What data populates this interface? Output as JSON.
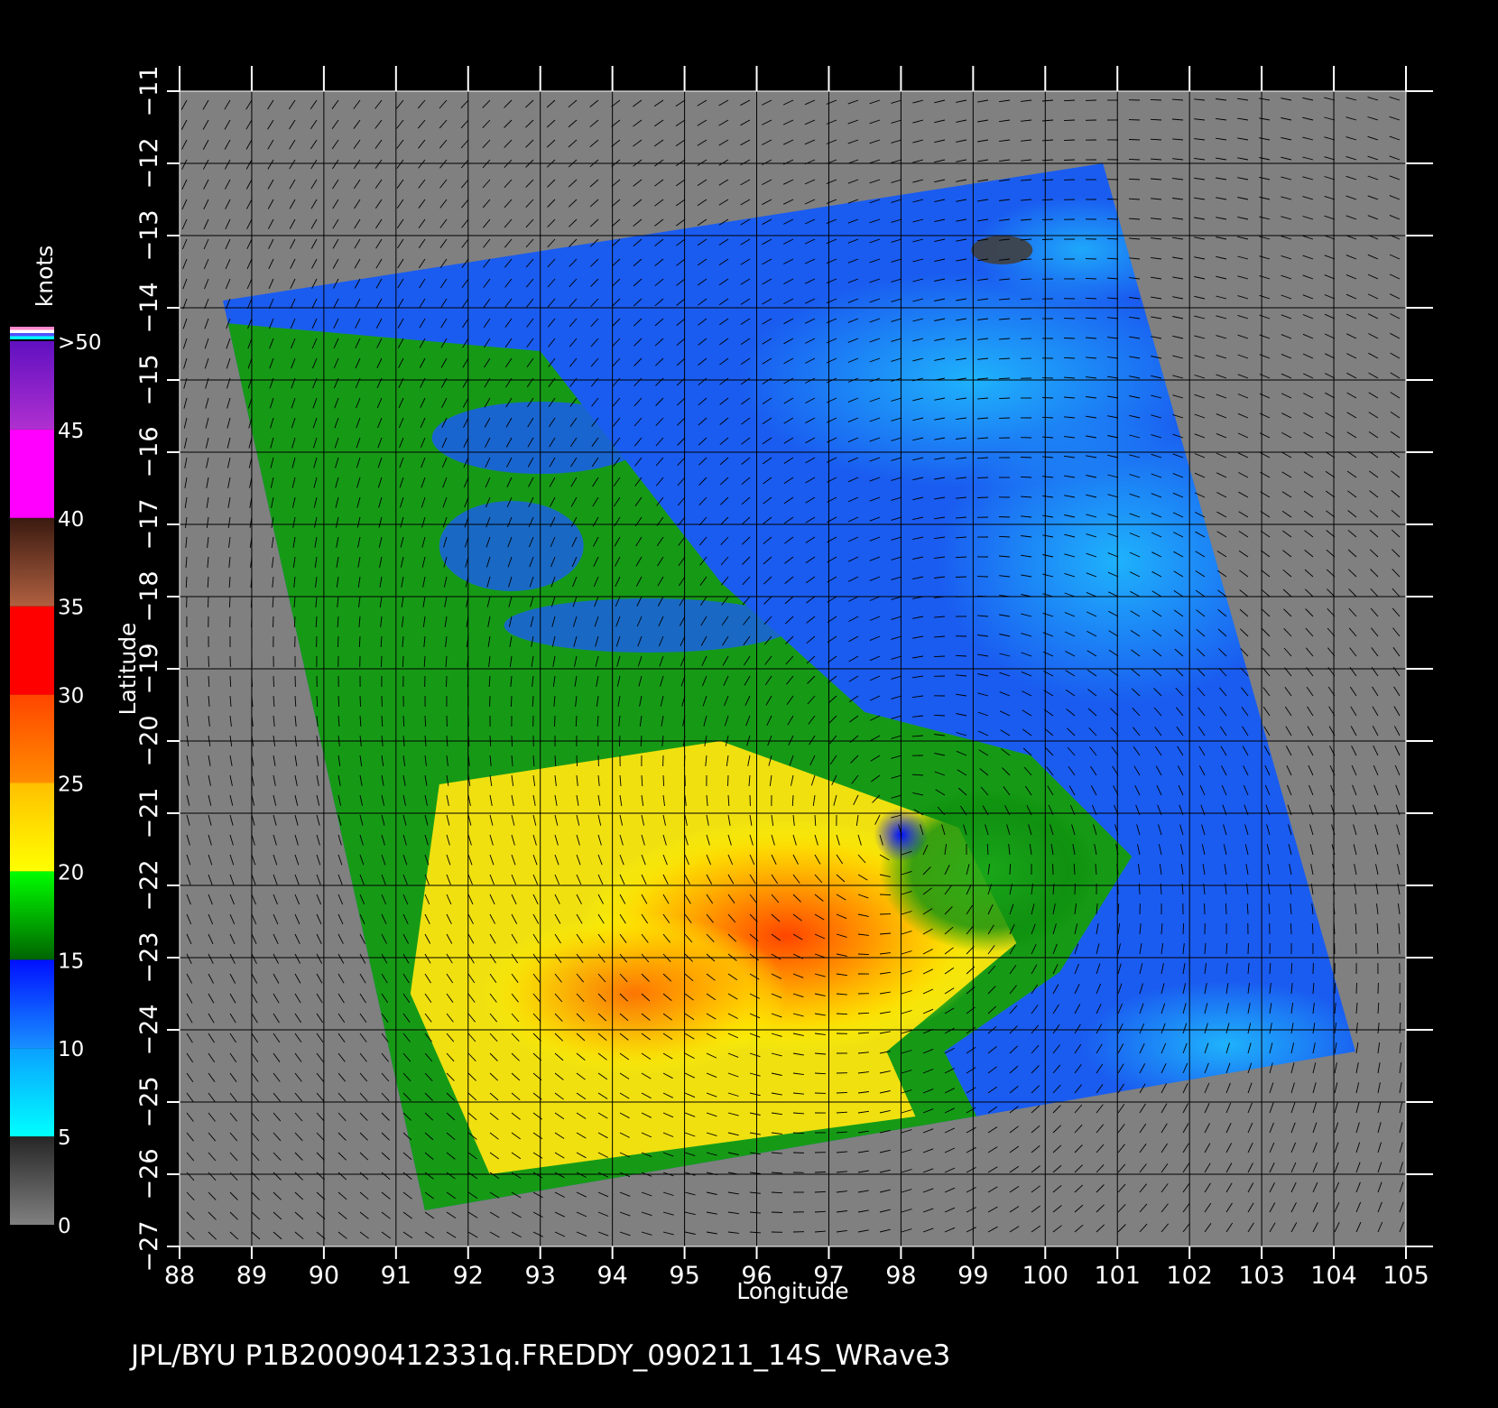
{
  "chart_data": {
    "type": "heatmap",
    "title": "",
    "xlabel": "Longitude",
    "ylabel": "Latitude",
    "xlim": [
      88,
      105
    ],
    "ylim": [
      -27,
      -11
    ],
    "x_ticks": [
      "88",
      "89",
      "90",
      "91",
      "92",
      "93",
      "94",
      "95",
      "96",
      "97",
      "98",
      "99",
      "100",
      "101",
      "102",
      "103",
      "104",
      "105"
    ],
    "y_ticks": [
      "−11",
      "−12",
      "−13",
      "−14",
      "−15",
      "−16",
      "−17",
      "−18",
      "−19",
      "−20",
      "−21",
      "−22",
      "−23",
      "−24",
      "−25",
      "−26",
      "−27"
    ],
    "x_tick_values": [
      88,
      89,
      90,
      91,
      92,
      93,
      94,
      95,
      96,
      97,
      98,
      99,
      100,
      101,
      102,
      103,
      104,
      105
    ],
    "y_tick_values": [
      -11,
      -12,
      -13,
      -14,
      -15,
      -16,
      -17,
      -18,
      -19,
      -20,
      -21,
      -22,
      -23,
      -24,
      -25,
      -26,
      -27
    ],
    "grid": true,
    "colorbar": {
      "title": "knots",
      "labels": [
        "0",
        "5",
        "10",
        "15",
        "20",
        "25",
        "30",
        "35",
        "40",
        "45",
        ">50"
      ],
      "values": [
        0,
        5,
        10,
        15,
        20,
        25,
        30,
        35,
        40,
        45,
        50
      ],
      "bins": [
        {
          "from": 0,
          "to": 5,
          "colors": [
            "#808080",
            "#262626"
          ]
        },
        {
          "from": 5,
          "to": 10,
          "colors": [
            "#00ffff",
            "#0aa0ff"
          ]
        },
        {
          "from": 10,
          "to": 15,
          "colors": [
            "#1890ff",
            "#0010ff"
          ]
        },
        {
          "from": 15,
          "to": 20,
          "colors": [
            "#006400",
            "#00ff00"
          ]
        },
        {
          "from": 20,
          "to": 25,
          "colors": [
            "#ffff00",
            "#ffc000"
          ]
        },
        {
          "from": 25,
          "to": 30,
          "colors": [
            "#ff8c00",
            "#ff4500"
          ]
        },
        {
          "from": 30,
          "to": 35,
          "colors": [
            "#ff0000",
            "#ff0000"
          ]
        },
        {
          "from": 35,
          "to": 40,
          "colors": [
            "#b06040",
            "#3a1a10"
          ]
        },
        {
          "from": 40,
          "to": 45,
          "colors": [
            "#ff00ff",
            "#ff00ff"
          ]
        },
        {
          "from": 45,
          "to": 50,
          "colors": [
            "#b030d0",
            "#6010c0"
          ]
        }
      ]
    },
    "swath_corners_lonlat": [
      [
        88.6,
        -13.9
      ],
      [
        100.8,
        -12.0
      ],
      [
        104.3,
        -24.3
      ],
      [
        91.4,
        -26.5
      ]
    ],
    "storm_center_lonlat": [
      98.0,
      -21.3
    ],
    "storm_name": "FREDDY"
  },
  "caption": "JPL/BYU  P1B20090412331q.FREDDY_090211_14S_WRave3"
}
